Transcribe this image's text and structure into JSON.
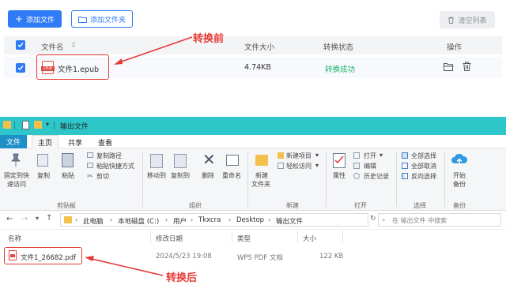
{
  "app": {
    "add_file_label": "添加文件",
    "add_folder_label": "添加文件夹",
    "clear_list_label": "清空列表",
    "columns": {
      "name": "文件名",
      "size": "文件大小",
      "status": "转换状态",
      "action": "操作"
    },
    "row": {
      "file_name": "文件1.epub",
      "file_badge": "EPUB",
      "size": "4.74KB",
      "status": "转换成功",
      "status_color": "#19b36b"
    },
    "annotation_before": "转换前"
  },
  "explorer": {
    "title": "输出文件",
    "tabs": [
      "文件",
      "主页",
      "共享",
      "查看"
    ],
    "ribbon": {
      "pin_label": "固定到快速访问",
      "pin_line1": "固定到快",
      "pin_line2": "速访问",
      "copy_label": "复制",
      "paste_label": "粘贴",
      "copy_path_label": "复制路径",
      "paste_shortcut_label": "粘贴快捷方式",
      "cut_label": "剪切",
      "clipboard_group": "剪贴板",
      "move_to_label": "移动到",
      "copy_to_label": "复制到",
      "delete_label": "删除",
      "rename_label": "重命名",
      "organize_group": "组织",
      "new_item_label": "新建项目",
      "easy_access_label": "轻松访问",
      "new_folder_line1": "新建",
      "new_folder_line2": "文件夹",
      "new_group": "新建",
      "properties_label": "属性",
      "open_label": "打开",
      "edit_label": "编辑",
      "history_label": "历史记录",
      "open_group": "打开",
      "select_all_label": "全部选择",
      "select_none_label": "全部取消",
      "invert_label": "反向选择",
      "select_group": "选择",
      "backup_line1": "开始",
      "backup_line2": "备份",
      "backup_group": "备份"
    },
    "path": [
      "此电脑",
      "本地磁盘 (C:)",
      "用户",
      "Tkxcra",
      "Desktop",
      "输出文件"
    ],
    "search_placeholder": "在 输出文件 中搜索",
    "columns": {
      "name": "名称",
      "modified": "修改日期",
      "type": "类型",
      "size": "大小"
    },
    "file": {
      "name": "文件1_26682.pdf",
      "modified": "2024/5/23 19:08",
      "type": "WPS PDF 文档",
      "size": "122 KB"
    },
    "annotation_after": "转换后"
  },
  "colors": {
    "primary": "#2f7bf5",
    "annotation": "#e53a36",
    "titlebar": "#2ec7c9",
    "file_tab": "#1e90c8"
  }
}
